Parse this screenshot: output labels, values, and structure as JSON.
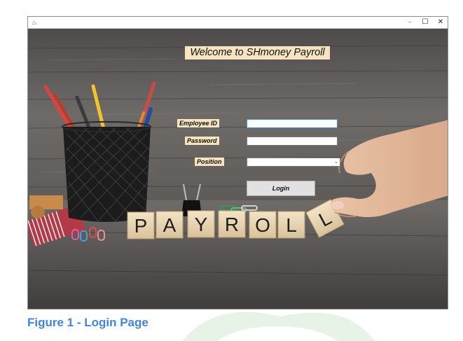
{
  "window": {
    "title": "",
    "app_icon": "java-cup-icon",
    "controls": {
      "minimize": "–",
      "maximize": "☐",
      "close": "✕"
    }
  },
  "login_form": {
    "heading": "Welcome to SHmoney Payroll",
    "employee_id": {
      "label": "Employee ID",
      "value": ""
    },
    "password": {
      "label": "Password",
      "value": ""
    },
    "position": {
      "label": "Position",
      "selected": ""
    },
    "login_button": "Login"
  },
  "background_photo": {
    "blocks": [
      "P",
      "A",
      "Y",
      "R",
      "O",
      "L",
      "L"
    ]
  },
  "caption": "Figure 1 - Login Page",
  "colors": {
    "label_bg": "#f6e3bf",
    "caption": "#3f84e0",
    "wood_bg": "#5a5654"
  }
}
